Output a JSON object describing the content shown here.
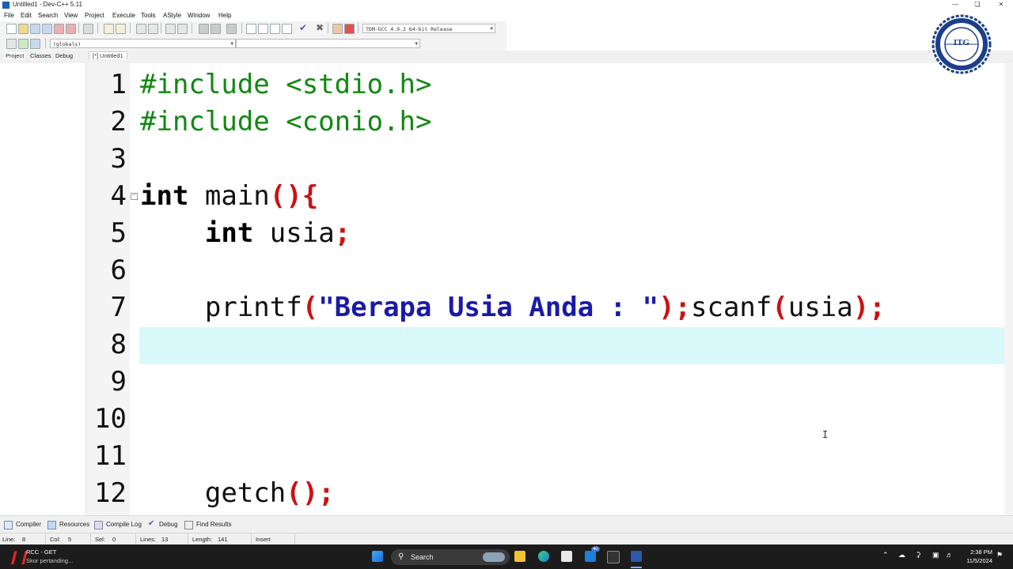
{
  "window": {
    "title": "Untitled1 - Dev-C++ 5.11"
  },
  "menu": [
    "File",
    "Edit",
    "Search",
    "View",
    "Project",
    "Execute",
    "Tools",
    "AStyle",
    "Window",
    "Help"
  ],
  "toolbar": {
    "compiler_select": "TDM-GCC 4.9.2 64-bit Release",
    "scope_select": "(globals)",
    "member_select": ""
  },
  "project_tabs": [
    "Project",
    "Classes",
    "Debug"
  ],
  "file_tab": "[*] Untitled1",
  "editor": {
    "line_numbers": [
      "1",
      "2",
      "3",
      "4",
      "5",
      "6",
      "7",
      "8",
      "9",
      "10",
      "11",
      "12"
    ],
    "current_line": 8,
    "lines": [
      [
        {
          "t": "#include <stdio.h>",
          "c": "pp"
        }
      ],
      [
        {
          "t": "#include <conio.h>",
          "c": "pp"
        }
      ],
      [],
      [
        {
          "t": "int",
          "c": "kw"
        },
        {
          "t": " main",
          "c": ""
        },
        {
          "t": "(){",
          "c": "pn"
        }
      ],
      [
        {
          "t": "    ",
          "c": ""
        },
        {
          "t": "int",
          "c": "kw"
        },
        {
          "t": " usia",
          "c": ""
        },
        {
          "t": ";",
          "c": "pn"
        }
      ],
      [],
      [
        {
          "t": "    printf",
          "c": ""
        },
        {
          "t": "(",
          "c": "pn"
        },
        {
          "t": "\"Berapa Usia Anda : \"",
          "c": "st"
        },
        {
          "t": ");",
          "c": "pn"
        },
        {
          "t": "scanf",
          "c": ""
        },
        {
          "t": "(",
          "c": "pn"
        },
        {
          "t": "usia",
          "c": ""
        },
        {
          "t": ");",
          "c": "pn"
        }
      ],
      [],
      [],
      [],
      [],
      [
        {
          "t": "    getch",
          "c": ""
        },
        {
          "t": "();",
          "c": "pn"
        }
      ]
    ]
  },
  "bottom_tabs": [
    "Compiler",
    "Resources",
    "Compile Log",
    "Debug",
    "Find Results"
  ],
  "status": {
    "line_label": "Line:",
    "line_value": "8",
    "col_label": "Col:",
    "col_value": "5",
    "sel_label": "Sel:",
    "sel_value": "0",
    "lines_label": "Lines:",
    "lines_value": "13",
    "length_label": "Length:",
    "length_value": "141",
    "mode": "Insert"
  },
  "taskbar": {
    "notification_title": "RCC - GET",
    "notification_sub": "Skor pertanding...",
    "search_placeholder": "Search",
    "time": "2:38 PM",
    "date": "11/5/2024",
    "badge": "40"
  },
  "logo": {
    "text": "ITG",
    "ring_text": "INSTITUT TEKNOLOGI GARUT"
  },
  "colors": {
    "preprocessor": "#118811",
    "punctuation": "#cc1111",
    "string": "#1a1aa8",
    "current_line": "#d9f8fa"
  }
}
